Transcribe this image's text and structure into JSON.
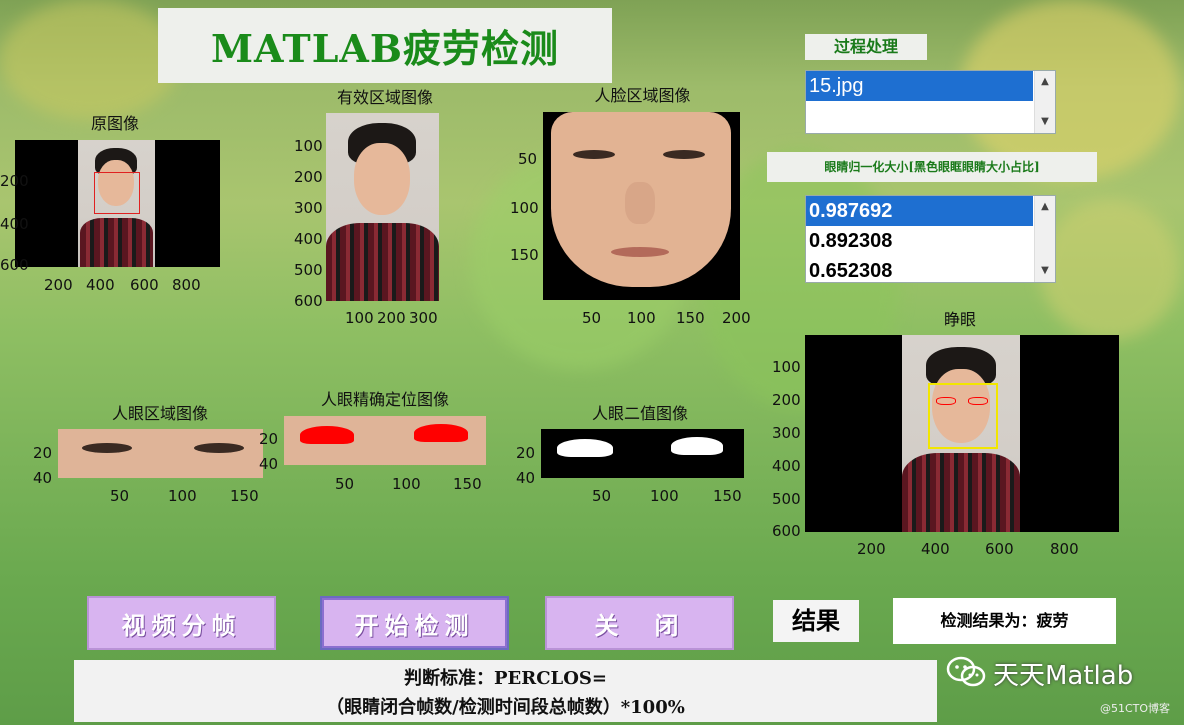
{
  "title": "MATLAB疲劳检测",
  "process": {
    "label": "过程处理",
    "files": [
      "15.jpg"
    ]
  },
  "eye_size": {
    "label": "眼睛归一化大小[黑色眼眶眼睛大小占比]",
    "values": [
      "0.987692",
      "0.892308",
      "0.652308"
    ]
  },
  "axes": {
    "original": {
      "title": "原图像",
      "yticks": [
        "200",
        "400",
        "600"
      ],
      "xticks": [
        "200",
        "400",
        "600",
        "800"
      ]
    },
    "valid": {
      "title": "有效区域图像",
      "yticks": [
        "100",
        "200",
        "300",
        "400",
        "500",
        "600"
      ],
      "xticks": [
        "100",
        "200",
        "300"
      ]
    },
    "face": {
      "title": "人脸区域图像",
      "yticks": [
        "50",
        "100",
        "150"
      ],
      "xticks": [
        "50",
        "100",
        "150",
        "200"
      ]
    },
    "eye_region": {
      "title": "人眼区域图像",
      "yticks": [
        "20",
        "40"
      ],
      "xticks": [
        "50",
        "100",
        "150"
      ]
    },
    "eye_locate": {
      "title": "人眼精确定位图像",
      "yticks": [
        "20",
        "40"
      ],
      "xticks": [
        "50",
        "100",
        "150"
      ]
    },
    "eye_binary": {
      "title": "人眼二值图像",
      "yticks": [
        "20",
        "40"
      ],
      "xticks": [
        "50",
        "100",
        "150"
      ]
    },
    "status": {
      "title": "睁眼",
      "yticks": [
        "100",
        "200",
        "300",
        "400",
        "500",
        "600"
      ],
      "xticks": [
        "200",
        "400",
        "600",
        "800"
      ]
    }
  },
  "buttons": {
    "video_split": "视频分帧",
    "start_detect": "开始检测",
    "close": "关　闭"
  },
  "result": {
    "label": "结果",
    "value": "检测结果为：疲劳"
  },
  "criterion": {
    "line1": "判断标准：PERCLOS=",
    "line2": "（眼睛闭合帧数/检测时间段总帧数）*100%"
  },
  "watermark": {
    "brand": "天天Matlab",
    "site": "@51CTO博客"
  },
  "colors": {
    "title_green": "#1a8b1a",
    "list_selected": "#1e6fd1",
    "button_purple": "#d8b4f0",
    "face_box_red": "#e02020",
    "face_box_yellow": "#f2e600",
    "eye_red": "#ff0000"
  },
  "icons": [
    "up-arrow-icon",
    "down-arrow-icon",
    "wechat-icon"
  ]
}
